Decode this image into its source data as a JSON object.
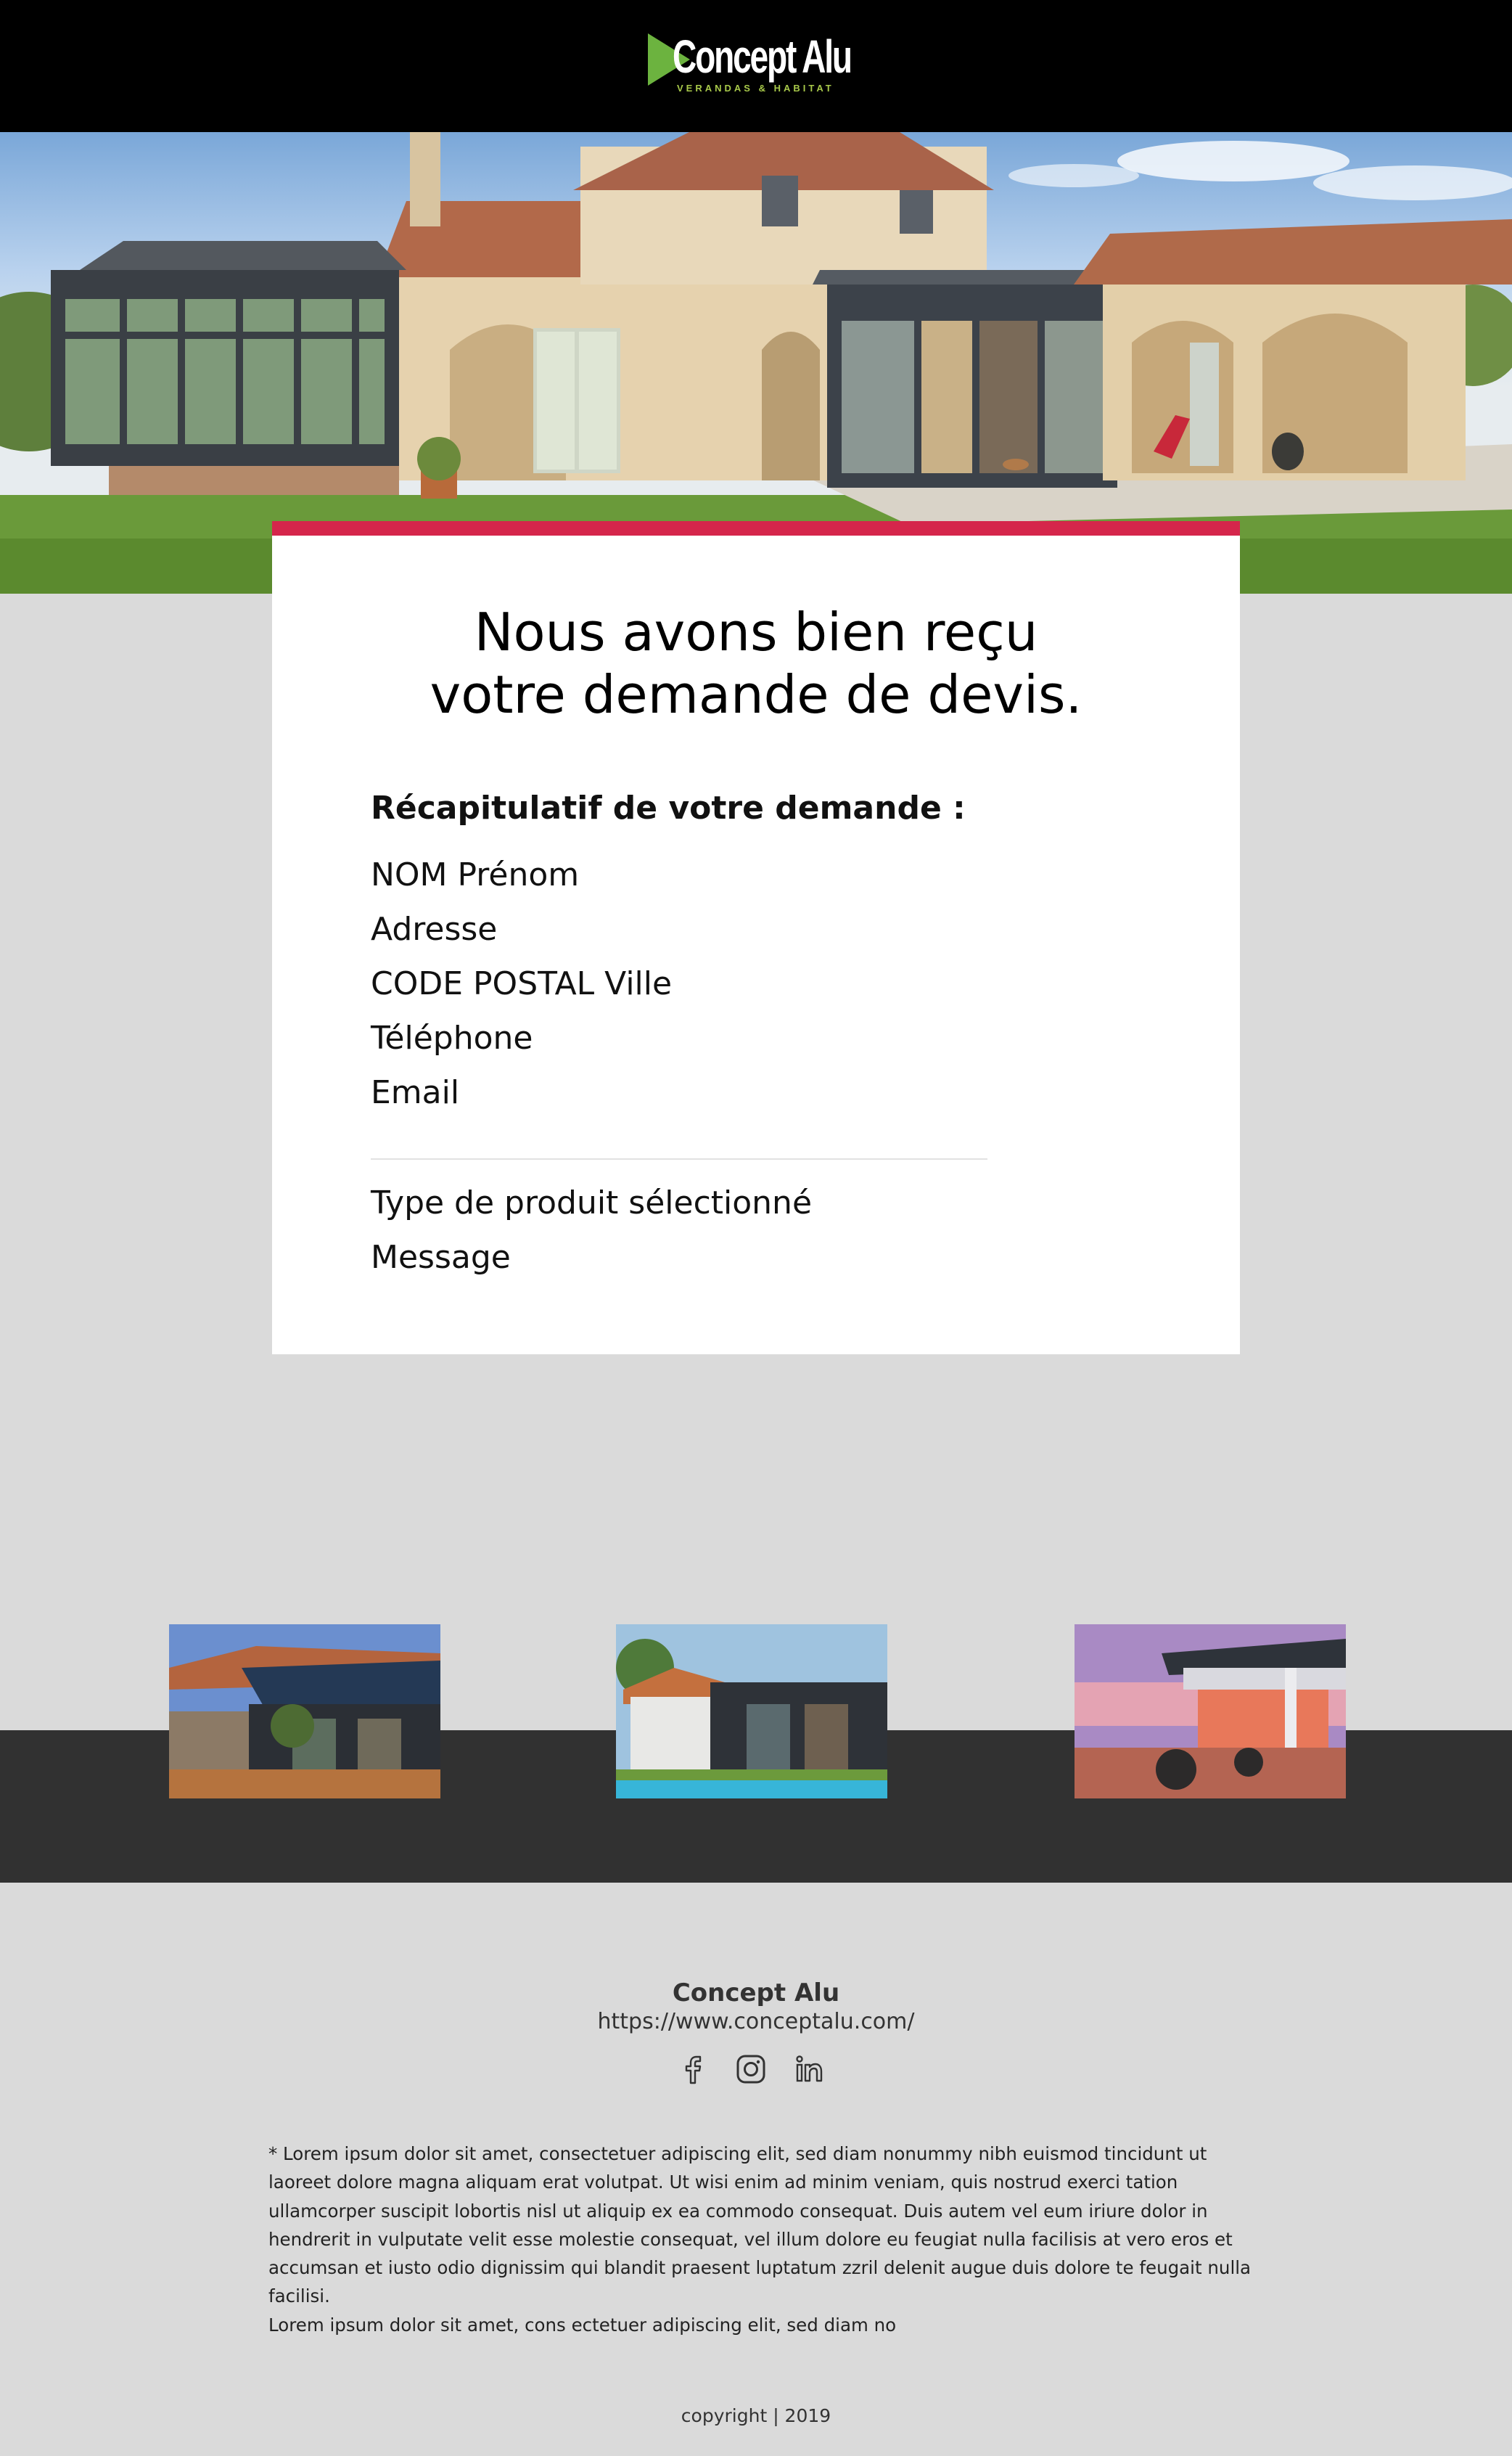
{
  "brand": {
    "name": "Concept Alu",
    "tagline": "VERANDAS & HABITAT",
    "colors": {
      "accent": "#d5264b",
      "logo_green": "#6cb33f",
      "header_bg": "#000000",
      "band_bg": "#313131",
      "page_bg": "#dadada"
    }
  },
  "confirmation": {
    "title_line1": "Nous avons bien reçu",
    "title_line2": "votre demande de devis.",
    "recap_heading": "Récapitulatif de votre demande :",
    "fields": [
      "NOM Prénom",
      "Adresse",
      "CODE POSTAL Ville",
      "Téléphone",
      "Email"
    ],
    "fields2": [
      "Type de produit sélectionné",
      "Message"
    ]
  },
  "footer": {
    "company": "Concept Alu",
    "url": "https://www.conceptalu.com/",
    "socials": [
      "facebook-icon",
      "instagram-icon",
      "linkedin-icon"
    ],
    "disclaimer_line1": "* Lorem ipsum dolor sit amet, consectetuer adipiscing elit, sed diam nonummy nibh euismod tincidunt ut laoreet dolore magna aliquam erat volutpat. Ut wisi enim ad minim veniam, quis nostrud exerci tation ullamcorper suscipit lobortis nisl ut aliquip ex ea commodo consequat. Duis autem vel eum iriure dolor in hendrerit in vulputate velit esse molestie consequat, vel illum dolore eu feugiat nulla facilisis at vero eros et accumsan et iusto odio dignissim qui blandit praesent luptatum zzril delenit augue duis dolore te feugait nulla facilisi.",
    "disclaimer_line2": "Lorem ipsum dolor sit amet, cons ectetuer adipiscing elit, sed diam no",
    "copyright": "copyright | 2019"
  }
}
